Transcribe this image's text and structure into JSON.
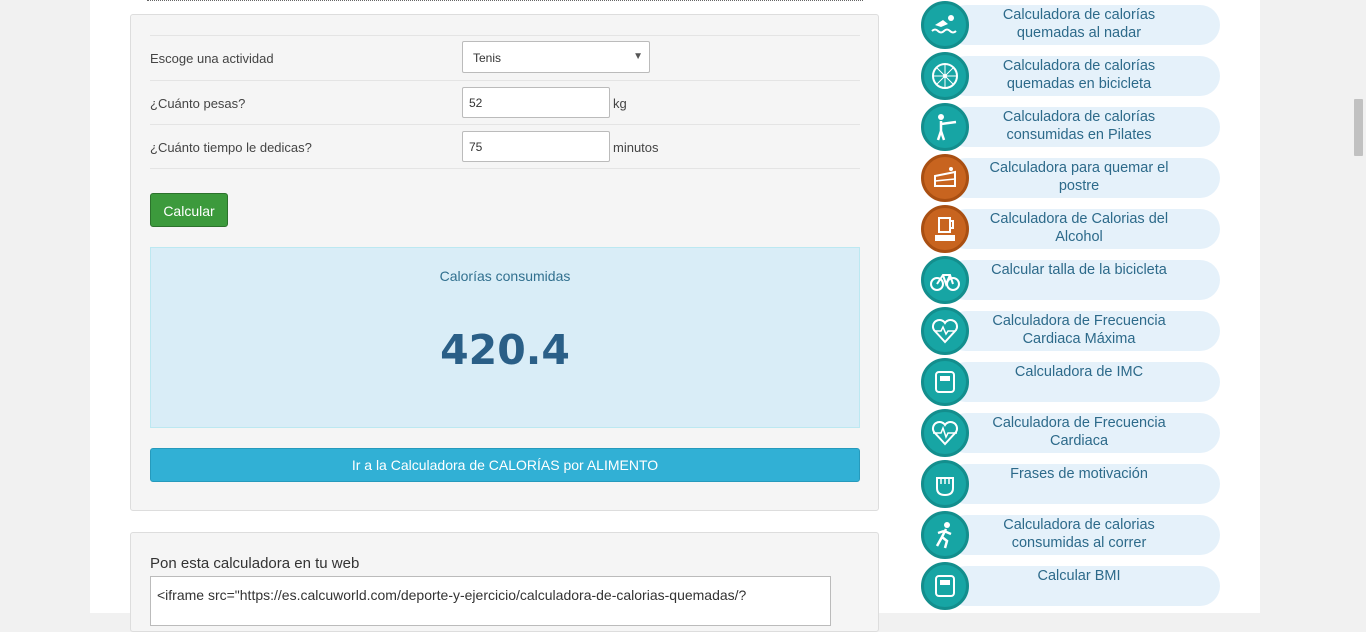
{
  "form": {
    "activity_label": "Escoge una actividad",
    "activity_value": "Tenis",
    "weight_label": "¿Cuánto pesas?",
    "weight_value": "52",
    "weight_unit": "kg",
    "time_label": "¿Cuánto tiempo le dedicas?",
    "time_value": "75",
    "time_unit": "minutos",
    "calc_button": "Calcular"
  },
  "result": {
    "title": "Calorías consumidas",
    "value": "420.4"
  },
  "food_button": "Ir a la Calculadora de CALORÍAS por ALIMENTO",
  "embed": {
    "title": "Pon esta calculadora en tu web",
    "code": "<iframe src=\"https://es.calcuworld.com/deporte-y-ejercicio/calculadora-de-calorias-quemadas/?"
  },
  "sidebar": {
    "items": [
      {
        "line1": "Calculadora de calorías",
        "line2": "quemadas al nadar",
        "icon": "swimmer-icon",
        "color": "#17a5a4"
      },
      {
        "line1": "Calculadora de calorías",
        "line2": "quemadas en bicicleta",
        "icon": "wheel-icon",
        "color": "#17a5a4"
      },
      {
        "line1": "Calculadora de calorías",
        "line2": "consumidas en Pilates",
        "icon": "pilates-icon",
        "color": "#17a5a4"
      },
      {
        "line1": "Calculadora para quemar el",
        "line2": "postre",
        "icon": "cake-icon",
        "color": "#c8641f"
      },
      {
        "line1": "Calculadora de Calorias del",
        "line2": "Alcohol",
        "icon": "beer-kcal-icon",
        "color": "#c8641f"
      },
      {
        "line1": "Calcular talla de la bicicleta",
        "line2": "",
        "icon": "bicycle-icon",
        "color": "#17a5a4"
      },
      {
        "line1": "Calculadora de Frecuencia",
        "line2": "Cardiaca Máxima",
        "icon": "heart-max-icon",
        "color": "#17a5a4"
      },
      {
        "line1": "Calculadora de IMC",
        "line2": "",
        "icon": "scale-imc-icon",
        "color": "#17a5a4"
      },
      {
        "line1": "Calculadora de Frecuencia",
        "line2": "Cardiaca",
        "icon": "heart-rate-icon",
        "color": "#17a5a4"
      },
      {
        "line1": "Frases de motivación",
        "line2": "",
        "icon": "fist-icon",
        "color": "#17a5a4"
      },
      {
        "line1": "Calculadora de calorias",
        "line2": "consumidas al correr",
        "icon": "runner-icon",
        "color": "#17a5a4"
      },
      {
        "line1": "Calcular BMI",
        "line2": "",
        "icon": "scale-bmi-icon",
        "color": "#17a5a4"
      }
    ]
  }
}
